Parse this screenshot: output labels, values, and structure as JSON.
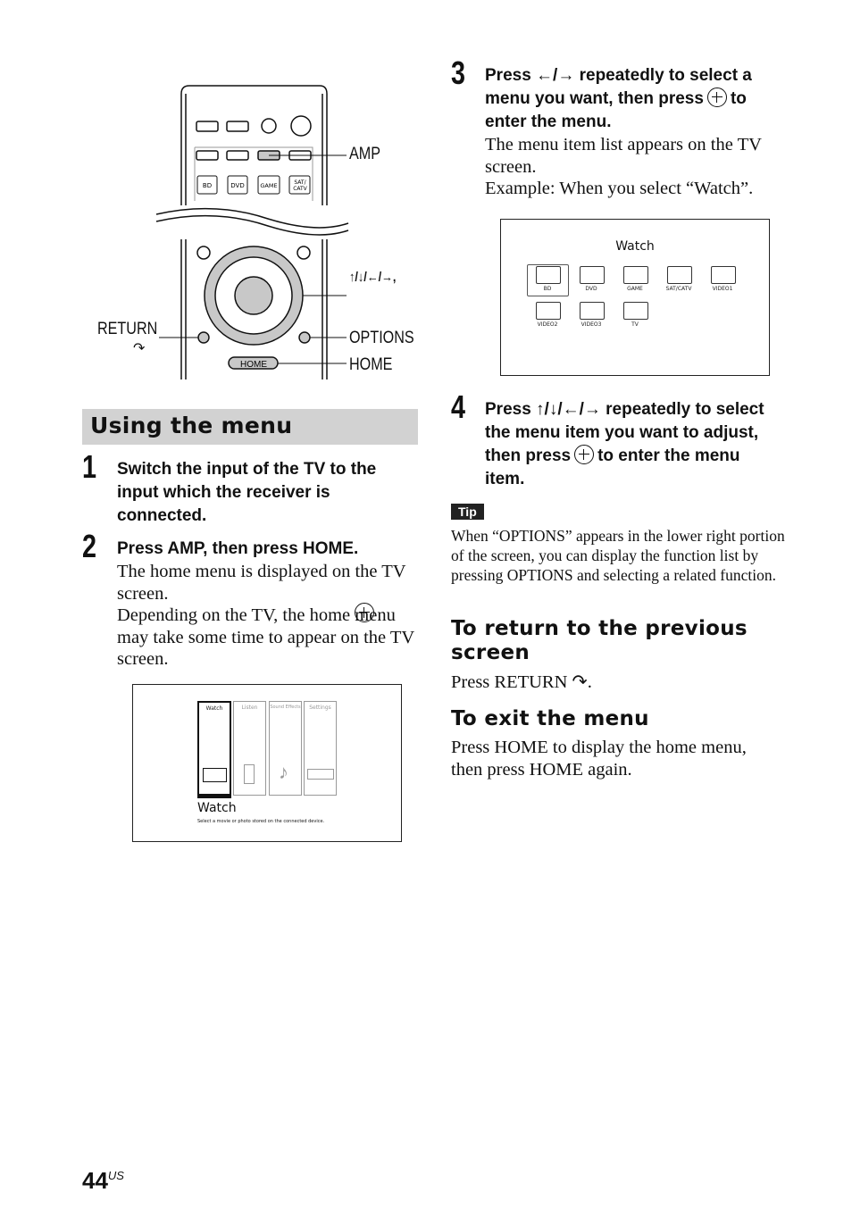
{
  "remote": {
    "buttons": [
      "BD",
      "DVD",
      "GAME",
      "SAT/\nCATV"
    ],
    "callouts": {
      "amp": "AMP",
      "arrows": "↑/↓/←/→,",
      "return": "RETURN",
      "options": "OPTIONS",
      "home": "HOME"
    },
    "home_button_label": "HOME"
  },
  "section": {
    "title": "Using the menu"
  },
  "steps": [
    {
      "num": "1",
      "head": "Switch the input of the TV to the input which the receiver is connected.",
      "body": []
    },
    {
      "num": "2",
      "head": "Press AMP, then press HOME.",
      "body": [
        "The home menu is displayed on the TV screen.",
        "Depending on the TV, the home menu may take some time to appear on the TV screen."
      ]
    },
    {
      "num": "3",
      "head_a": "Press ←/→ repeatedly to select a menu you want, then press",
      "head_b": "to enter the menu.",
      "body": [
        "The menu item list appears on the TV screen.",
        "Example: When you select “Watch”."
      ]
    },
    {
      "num": "4",
      "head_a": "Press ↑/↓/←/→ repeatedly to select the menu item you want to adjust, then press",
      "head_b": "to enter the menu item."
    }
  ],
  "home_screen": {
    "tabs": [
      "Watch",
      "Listen",
      "Sound Effects",
      "Settings"
    ],
    "selected": "Watch",
    "title": "Watch",
    "description": "Select a movie or photo stored on the connected device."
  },
  "watch_screen": {
    "title": "Watch",
    "items": [
      "BD",
      "DVD",
      "GAME",
      "SAT/CATV",
      "VIDEO1",
      "VIDEO2",
      "VIDEO3",
      "TV"
    ],
    "selected": "BD"
  },
  "tip": {
    "label": "Tip",
    "text": "When “OPTIONS” appears in the lower right portion of the screen, you can display the function list by pressing OPTIONS and selecting a related function."
  },
  "return_section": {
    "title": "To return to the previous screen",
    "text": "Press RETURN"
  },
  "exit_section": {
    "title": "To exit the menu",
    "text": "Press HOME to display the home menu, then press HOME again."
  },
  "footer": {
    "page": "44",
    "suffix": "US"
  },
  "colors": {
    "section_bar": "#d2d2d2",
    "button_gray": "#c8c8c8"
  }
}
